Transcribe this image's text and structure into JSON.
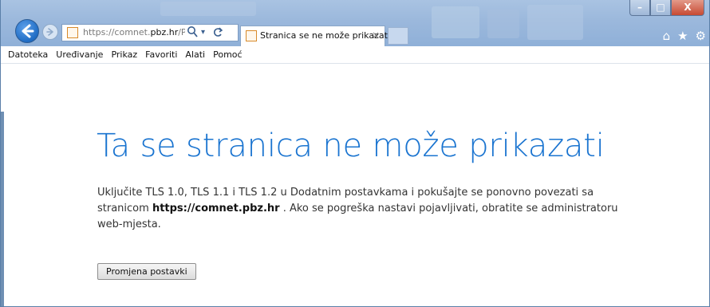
{
  "browser": {
    "address": {
      "prefix": "https://comnet.",
      "host": "pbz.hr",
      "suffix": "/PbzCc",
      "search_icon": "search-icon",
      "refresh_icon": "refresh-icon"
    },
    "active_tab": {
      "title": "Stranica se ne može prikazati",
      "close": "×"
    },
    "window_controls": {
      "minimize": "–",
      "maximize": "□",
      "close": "X"
    },
    "toolbar_icons": {
      "home": "⌂",
      "favorites": "★",
      "settings": "⚙"
    }
  },
  "menu": {
    "items": [
      "Datoteka",
      "Uređivanje",
      "Prikaz",
      "Favoriti",
      "Alati",
      "Pomoć"
    ]
  },
  "page": {
    "title": "Ta se stranica ne može prikazati",
    "body_before": "Uključite TLS 1.0, TLS 1.1 i TLS 1.2 u Dodatnim postavkama i pokušajte se ponovno povezati sa stranicom ",
    "body_url": "https://comnet.pbz.hr",
    "body_after": " . Ako se pogreška nastavi pojavljivati, obratite se administratoru web-mjesta.",
    "button_label": "Promjena postavki"
  },
  "colors": {
    "title_blue": "#1a74d0",
    "chrome_blue": "#9bb8dc",
    "back_button": "#1f6cc4",
    "close_red": "#c74a33"
  }
}
